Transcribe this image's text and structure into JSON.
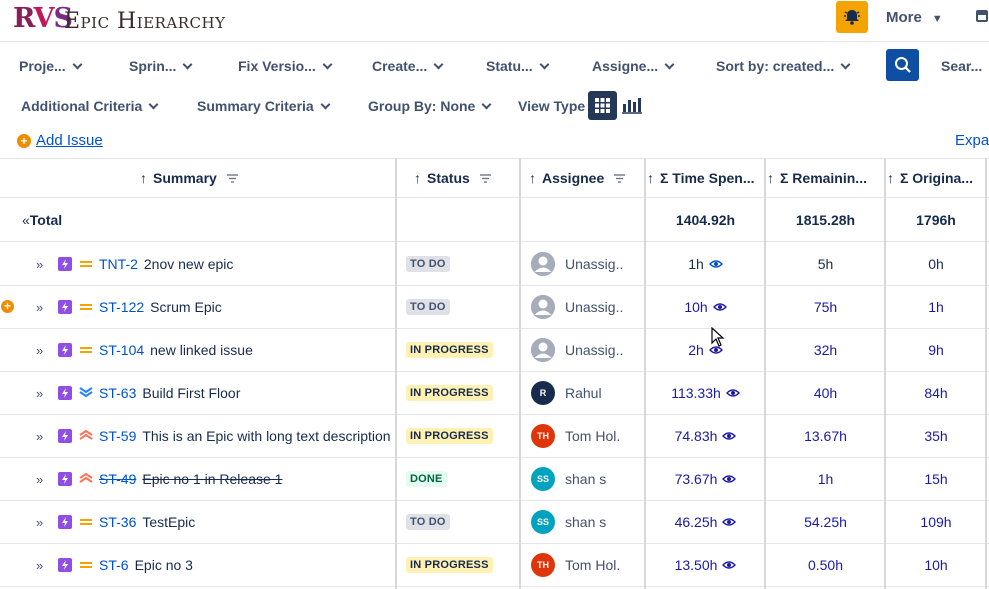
{
  "app": {
    "logo_r": "R",
    "logo_v": "V",
    "logo_s": "S",
    "title": "Epic Hierarchy",
    "more_label": "More"
  },
  "filters": {
    "row1": [
      {
        "label": "Proje..."
      },
      {
        "label": "Sprin..."
      },
      {
        "label": "Fix Versio..."
      },
      {
        "label": "Create..."
      },
      {
        "label": "Statu..."
      },
      {
        "label": "Assigne..."
      },
      {
        "label": "Sort by: created..."
      }
    ],
    "search_label": "Sear...",
    "row2": [
      {
        "label": "Additional Criteria"
      },
      {
        "label": "Summary Criteria"
      },
      {
        "label": "Group By: None"
      }
    ],
    "view_type_label": "View Type"
  },
  "actions": {
    "add_issue": "Add Issue",
    "expand": "Expar"
  },
  "table": {
    "headers": {
      "summary": "Summary",
      "status": "Status",
      "assignee": "Assignee",
      "time_spent": "Σ Time Spen...",
      "remaining": "Σ Remainin...",
      "original": "Σ Origina..."
    },
    "sort_arrow": "↑",
    "total": {
      "label": "Total",
      "collapse": "«",
      "time_spent": "1404.92h",
      "remaining": "1815.28h",
      "original": "1796h"
    },
    "rows": [
      {
        "key": "TNT-2",
        "summary": "2nov new epic",
        "priority": "medium",
        "status": "TO DO",
        "status_type": "todo",
        "assignee": "Unassig..",
        "avatar_initials": "",
        "avatar_color": "#a5adba",
        "time_spent": "1h",
        "remaining": "5h",
        "original": "0h",
        "linked": false,
        "done": false
      },
      {
        "key": "ST-122",
        "summary": "Scrum Epic",
        "priority": "medium",
        "status": "TO DO",
        "status_type": "todo",
        "assignee": "Unassig..",
        "avatar_initials": "",
        "avatar_color": "#a5adba",
        "time_spent": "10h",
        "remaining": "75h",
        "original": "1h",
        "linked": true,
        "done": false
      },
      {
        "key": "ST-104",
        "summary": "new linked issue",
        "priority": "medium",
        "status": "IN PROGRESS",
        "status_type": "progress",
        "assignee": "Unassig..",
        "avatar_initials": "",
        "avatar_color": "#a5adba",
        "time_spent": "2h",
        "remaining": "32h",
        "original": "9h",
        "linked": true,
        "done": false
      },
      {
        "key": "ST-63",
        "summary": "Build First Floor",
        "priority": "lowest",
        "status": "IN PROGRESS",
        "status_type": "progress",
        "assignee": "Rahul",
        "avatar_initials": "R",
        "avatar_color": "#172b4d",
        "time_spent": "113.33h",
        "remaining": "40h",
        "original": "84h",
        "linked": true,
        "done": false
      },
      {
        "key": "ST-59",
        "summary": "This is an Epic with long text description",
        "priority": "high",
        "status": "IN PROGRESS",
        "status_type": "progress",
        "assignee": "Tom Hol.",
        "avatar_initials": "TH",
        "avatar_color": "#de350b",
        "time_spent": "74.83h",
        "remaining": "13.67h",
        "original": "35h",
        "linked": true,
        "done": false
      },
      {
        "key": "ST-49",
        "summary": "Epic no 1 in Release 1",
        "priority": "high",
        "status": "DONE",
        "status_type": "done",
        "assignee": "shan s",
        "avatar_initials": "SS",
        "avatar_color": "#00a3bf",
        "time_spent": "73.67h",
        "remaining": "1h",
        "original": "15h",
        "linked": true,
        "done": true
      },
      {
        "key": "ST-36",
        "summary": "TestEpic",
        "priority": "medium",
        "status": "TO DO",
        "status_type": "todo",
        "assignee": "shan s",
        "avatar_initials": "SS",
        "avatar_color": "#00a3bf",
        "time_spent": "46.25h",
        "remaining": "54.25h",
        "original": "109h",
        "linked": true,
        "done": false
      },
      {
        "key": "ST-6",
        "summary": "Epic no 3",
        "priority": "medium",
        "status": "IN PROGRESS",
        "status_type": "progress",
        "assignee": "Tom Hol.",
        "avatar_initials": "TH",
        "avatar_color": "#de350b",
        "time_spent": "13.50h",
        "remaining": "0.50h",
        "original": "10h",
        "linked": true,
        "done": false
      }
    ]
  },
  "colors": {
    "accent": "#0e4fa3",
    "bell": "#f5a300",
    "epic": "#904ee2",
    "link": "#1a1aa6"
  }
}
